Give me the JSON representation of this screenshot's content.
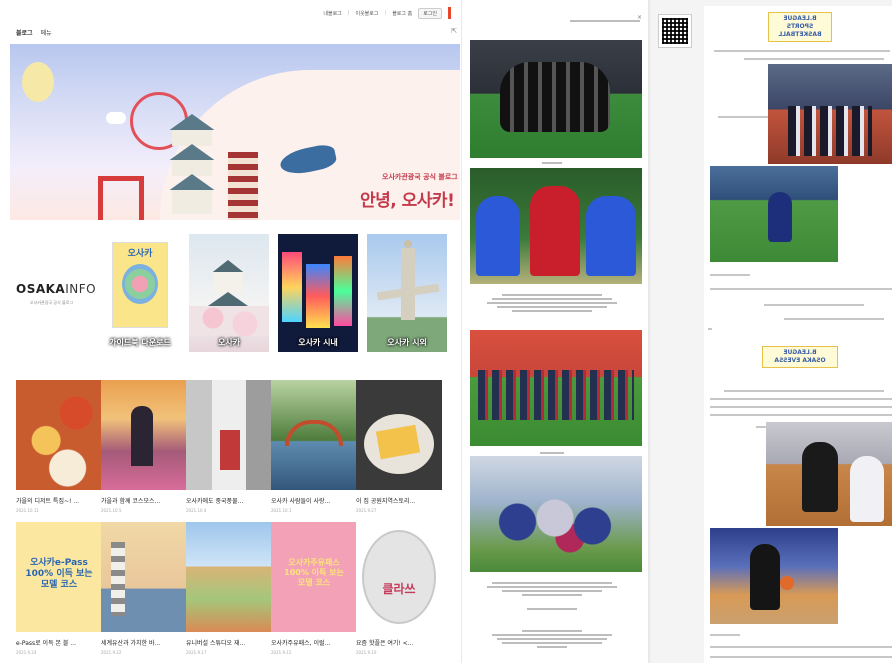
{
  "top_nav": {
    "items": [
      "내블로그",
      "이웃블로그",
      "블로그 홈"
    ],
    "login": "로그인"
  },
  "blog_tabs": [
    "블로그",
    "메뉴"
  ],
  "hero": {
    "subtitle": "오사카관광국 공식 블로그",
    "title": "안녕, 오사카!"
  },
  "brand": {
    "logo_bold": "OSAKA",
    "logo_light": "INFO",
    "tagline": "오사카관광국 공식 블로그"
  },
  "categories": [
    {
      "label": "가이드북 다운로드",
      "book_title": "오사카"
    },
    {
      "label": "오사카"
    },
    {
      "label": "오사카 시내"
    },
    {
      "label": "오사카 시외"
    }
  ],
  "posts": [
    {
      "title": "가을의 디저트 특집~! ...",
      "date": "2021.10.11"
    },
    {
      "title": "가을과 함께 코스모스...",
      "date": "2021.10.5"
    },
    {
      "title": "오사카에도 중국풍물...",
      "date": "2021.10.4"
    },
    {
      "title": "오사카 사람들이 사랑...",
      "date": "2021.10.1"
    },
    {
      "title": "이 집 공원지역스토리...",
      "date": "2021.9.27"
    },
    {
      "title": "e-Pass로 이득 본 블 ...",
      "date": "2021.9.24",
      "image_text": "오사카e-Pass\n100% 이득 보는\n모델 코스"
    },
    {
      "title": "세계유산과 가치한 바...",
      "date": "2021.9.22"
    },
    {
      "title": "유니버설 스튜디오 재...",
      "date": "2021.9.17"
    },
    {
      "title": "오사카주유패스, 이럴...",
      "date": "2021.9.15",
      "image_text": "오사카주유패스\n100% 이득 보는\n모델 코스"
    },
    {
      "title": "요즘 핫플은 여기! <...",
      "date": "2021.9.10",
      "image_text": "클라쓰"
    }
  ],
  "right_badges": [
    {
      "text": "B.LEAGUE\nSPORTS BASKETBALL"
    },
    {
      "text": "B.LEAGUE\nOSAKA EVESSA"
    }
  ],
  "colors": {
    "accent_red": "#c43a4a",
    "nav_red": "#e8462b",
    "yellow": "#fbe7a0",
    "pink": "#f3a1b6"
  }
}
